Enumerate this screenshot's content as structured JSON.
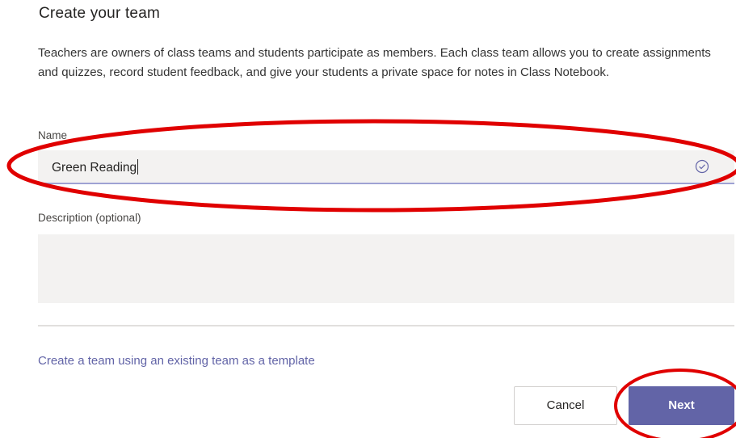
{
  "header": {
    "title": "Create your team"
  },
  "intro": {
    "text": "Teachers are owners of class teams and students participate as members. Each class team allows you to create assignments and quizzes, record student feedback, and give your students a private space for notes in Class Notebook."
  },
  "form": {
    "name_label": "Name",
    "name_value": "Green Reading",
    "name_status_icon": "check-circle-icon",
    "description_label": "Description (optional)",
    "description_value": ""
  },
  "links": {
    "template_link": "Create a team using an existing team as a template"
  },
  "actions": {
    "cancel_label": "Cancel",
    "next_label": "Next"
  },
  "colors": {
    "accent": "#6264a7",
    "annotation": "#e00000",
    "field_bg": "#f3f2f1"
  }
}
